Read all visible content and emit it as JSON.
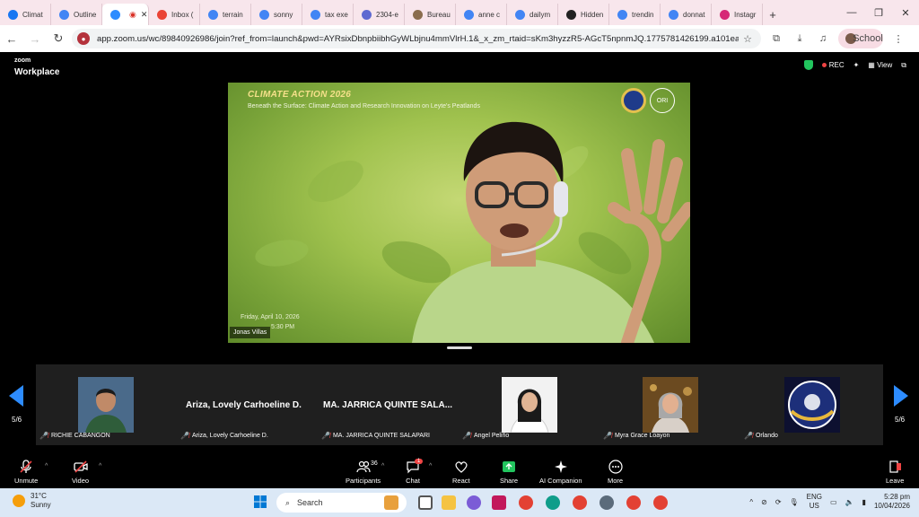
{
  "browser": {
    "tabs": [
      {
        "label": "Climat",
        "color": "#1877f2"
      },
      {
        "label": "Outline",
        "color": "#4285f4"
      },
      {
        "label": "",
        "color": "#2d8cff",
        "active": true
      },
      {
        "label": "Inbox (",
        "color": "#ea4335"
      },
      {
        "label": "terrain",
        "color": "#4285f4"
      },
      {
        "label": "sonny",
        "color": "#4285f4"
      },
      {
        "label": "tax exe",
        "color": "#4285f4"
      },
      {
        "label": "2304-e",
        "color": "#5f6ad1"
      },
      {
        "label": "Bureau",
        "color": "#8a6d4e"
      },
      {
        "label": "anne c",
        "color": "#4285f4"
      },
      {
        "label": "dailym",
        "color": "#4285f4"
      },
      {
        "label": "Hidden",
        "color": "#222222"
      },
      {
        "label": "trendin",
        "color": "#4285f4"
      },
      {
        "label": "donnat",
        "color": "#4285f4"
      },
      {
        "label": "Instagr",
        "color": "#d62976"
      }
    ],
    "url": "app.zoom.us/wc/89840926986/join?ref_from=launch&pwd=AYRsixDbnpbiibhGyWLbjnu4mmVlrH.1&_x_zm_rtaid=sKm3hyzzR5-AGcT5npnmJQ.1775781426199.a101eaf8c1...",
    "profile_label": "School"
  },
  "zoom": {
    "logo_top": "zoom",
    "logo_bottom": "Workplace",
    "rec_label": "REC",
    "view_label": "View",
    "slide_title": "CLIMATE ACTION 2026",
    "slide_subtitle": "Beneath the Surface: Climate Action and Research Innovation on Leyte's Peatlands",
    "seal_right": "ORI",
    "slide_date": "Friday, April 10, 2026",
    "slide_time": "5:30 PM",
    "speaker_name": "Jonas Villas",
    "page_indicator": "5/6",
    "participants": [
      {
        "name": "RICHIE CABANGON",
        "display": ""
      },
      {
        "name": "Ariza, Lovely Carhoeline D.",
        "display": "Ariza, Lovely Carhoeline D."
      },
      {
        "name": "MA. JARRICA QUINTE SALAPARI",
        "display": "MA. JARRICA QUINTE SALA..."
      },
      {
        "name": "Angel Peliño",
        "display": ""
      },
      {
        "name": "Myra Grace Loayon",
        "display": ""
      },
      {
        "name": "Orlando",
        "display": ""
      }
    ],
    "toolbar": {
      "unmute": "Unmute",
      "video": "Video",
      "participants": "Participants",
      "participants_count": "36",
      "chat": "Chat",
      "chat_badge": "1",
      "react": "React",
      "share": "Share",
      "ai": "AI Companion",
      "more": "More",
      "leave": "Leave"
    }
  },
  "taskbar": {
    "temp": "31°C",
    "weather": "Sunny",
    "search_placeholder": "Search",
    "lang_top": "ENG",
    "lang_bottom": "US",
    "time": "5:28 pm",
    "date": "10/04/2026"
  },
  "colors": {
    "accent": "#2d8cff",
    "share": "#22c55e",
    "mute": "#ef4444"
  }
}
